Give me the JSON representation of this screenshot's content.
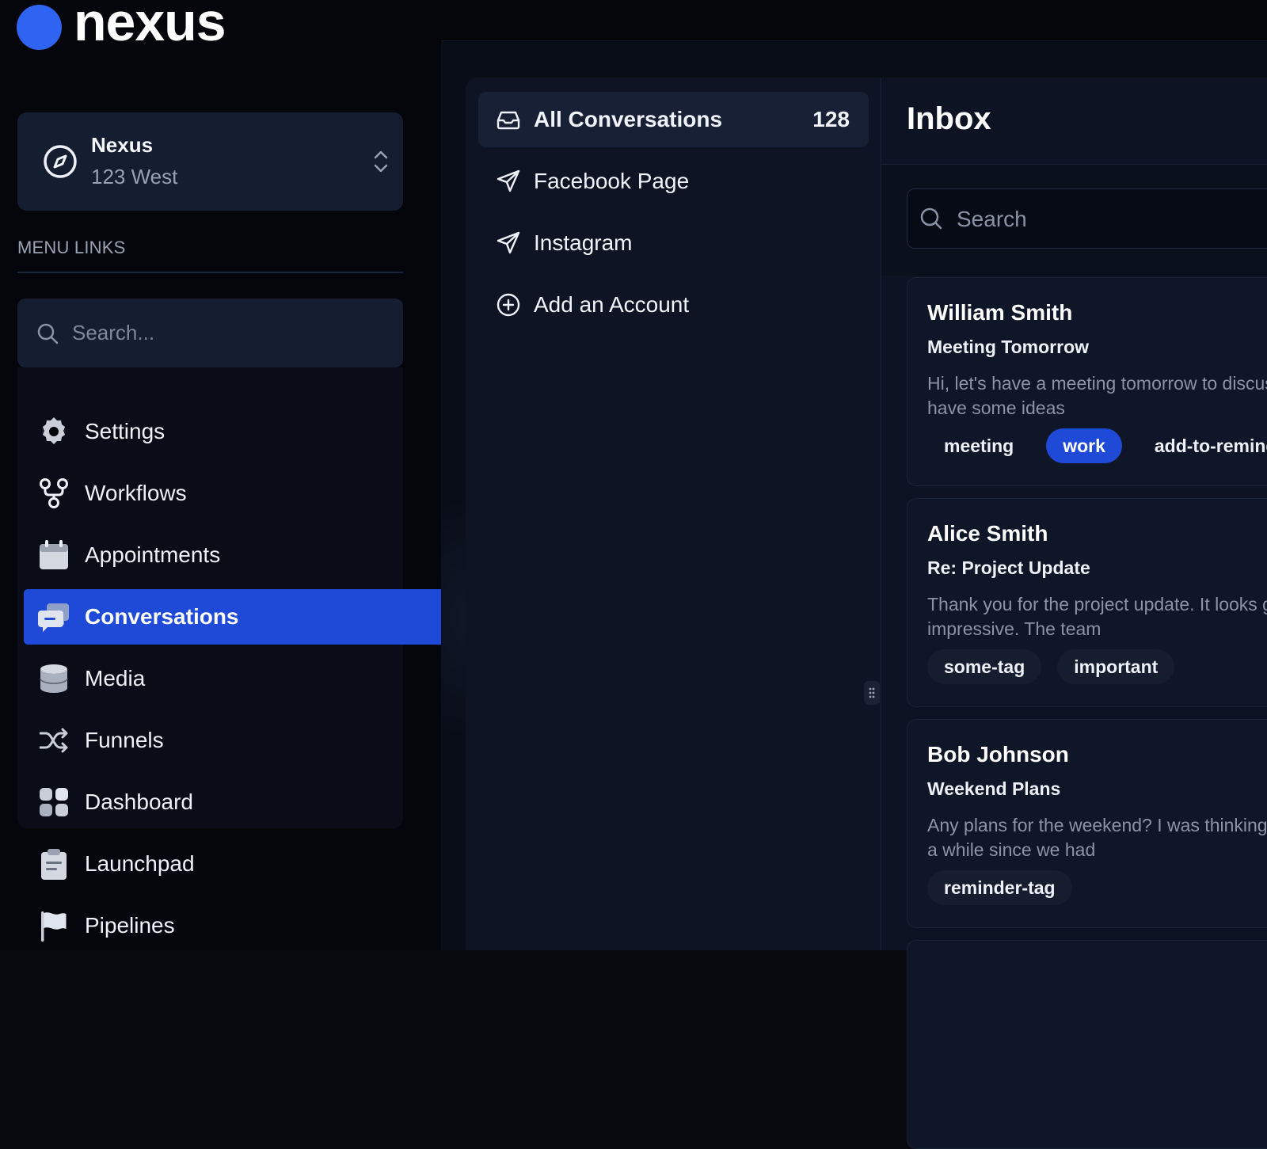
{
  "brand": {
    "name": "nexus",
    "accent": "#2f63f2"
  },
  "account": {
    "name": "Nexus",
    "address": "123 West",
    "icon": "compass-icon",
    "switch_icon": "chevron-updown-icon"
  },
  "sidebar": {
    "heading": "MENU LINKS",
    "search_placeholder": "Search...",
    "active_color": "#1f4ad8",
    "items": [
      {
        "label": "Settings",
        "icon": "gear-icon"
      },
      {
        "label": "Workflows",
        "icon": "workflow-icon"
      },
      {
        "label": "Appointments",
        "icon": "calendar-icon"
      },
      {
        "label": "Conversations",
        "icon": "chat-bubbles-icon",
        "active": true
      },
      {
        "label": "Media",
        "icon": "database-icon"
      },
      {
        "label": "Funnels",
        "icon": "shuffle-icon"
      },
      {
        "label": "Dashboard",
        "icon": "grid-icon"
      },
      {
        "label": "Launchpad",
        "icon": "clipboard-icon"
      },
      {
        "label": "Pipelines",
        "icon": "flag-icon"
      }
    ]
  },
  "channels": {
    "items": [
      {
        "label": "All Conversations",
        "icon": "inbox-tray-icon",
        "count": "128",
        "active": true
      },
      {
        "label": "Facebook Page",
        "icon": "send-icon"
      },
      {
        "label": "Instagram",
        "icon": "send-icon"
      },
      {
        "label": "Add an Account",
        "icon": "plus-circle-icon"
      }
    ]
  },
  "inbox": {
    "title": "Inbox",
    "search_placeholder": "Search",
    "messages": [
      {
        "name": "William Smith",
        "subject": "Meeting Tomorrow",
        "preview": "Hi, let's have a meeting tomorrow to discuss the project details and have some ideas",
        "tags": [
          "meeting",
          "work",
          "add-to-reminder"
        ]
      },
      {
        "name": "Alice Smith",
        "subject": "Re: Project Update",
        "preview": "Thank you for the project update. It looks great and the progress is impressive. The team",
        "tags": [
          "some-tag",
          "important"
        ]
      },
      {
        "name": "Bob Johnson",
        "subject": "Weekend Plans",
        "preview": "Any plans for the weekend? I was thinking of the mountains. It's been a while since we had",
        "tags": [
          "reminder-tag"
        ]
      }
    ]
  }
}
